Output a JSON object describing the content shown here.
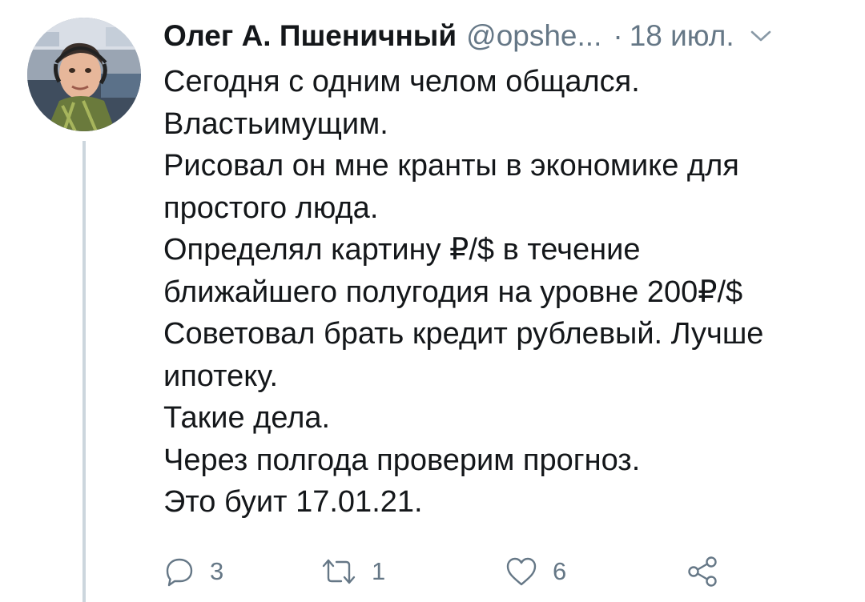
{
  "tweet": {
    "author_name": "Олег А. Пшеничный",
    "author_handle": "@opshe...",
    "separator": "·",
    "date": "18 июл.",
    "lines": [
      "Сегодня с одним челом общался.",
      "Властьимущим.",
      "Рисовал он мне кранты в экономике для",
      "простого люда.",
      "Определял картину ₽/$ в течение",
      "ближайшего полугодия на уровне 200₽/$",
      "Советовал брать кредит рублевый. Лучше",
      "ипотеку.",
      "Такие дела.",
      "Через полгода проверим прогноз.",
      "Это буит 17.01.21."
    ]
  },
  "actions": {
    "replies": "3",
    "retweets": "1",
    "likes": "6"
  },
  "icons": {
    "reply": "reply-icon",
    "retweet": "retweet-icon",
    "like": "heart-icon",
    "share": "share-icon",
    "menu": "chevron-down-icon"
  },
  "colors": {
    "text": "#14171a",
    "secondary": "#657786",
    "thread_line": "#ccd6dd"
  }
}
